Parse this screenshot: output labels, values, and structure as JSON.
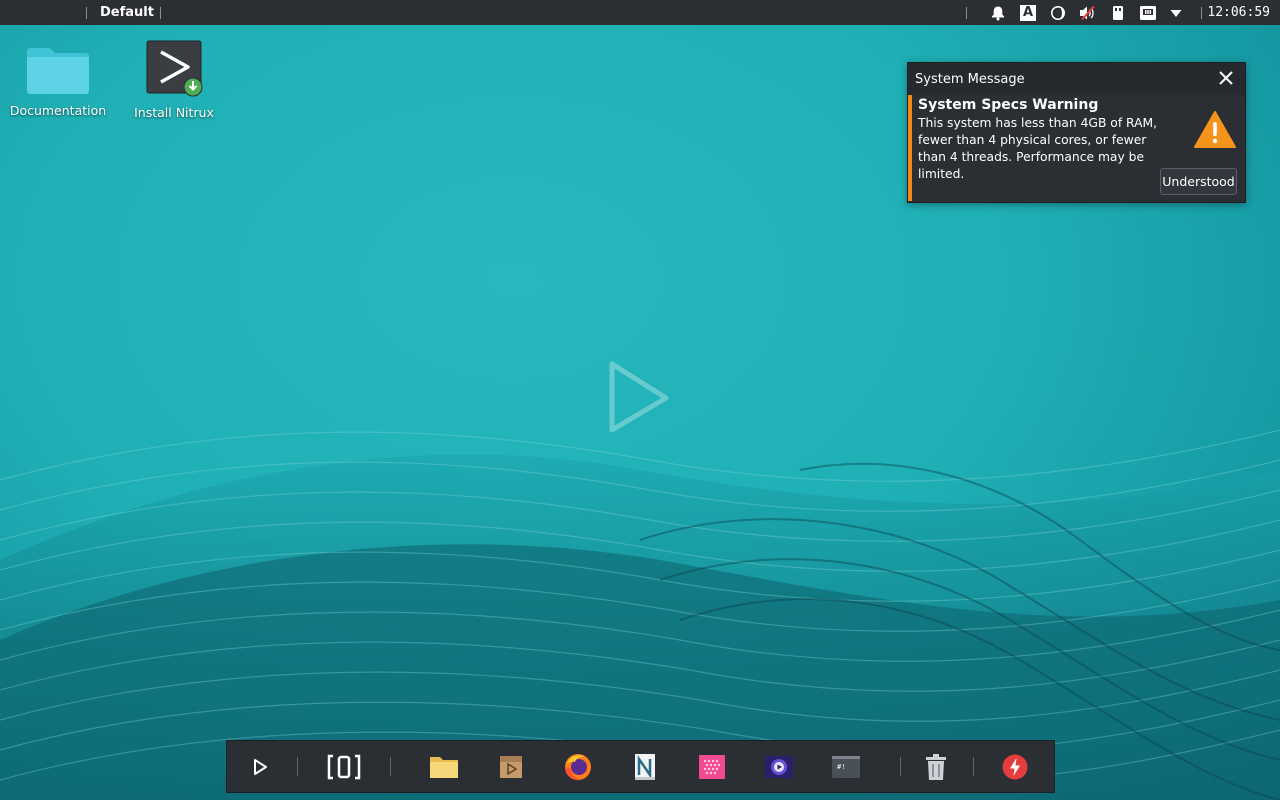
{
  "topbar": {
    "workspace_label": "Default",
    "clock": "12:06:59",
    "tray_icons": [
      "notifications-icon",
      "keyboard-layout-icon",
      "night-mode-icon",
      "volume-muted-icon",
      "usb-device-icon",
      "network-icon",
      "tray-expand-icon"
    ],
    "keyboard_letter": "A"
  },
  "desktop": {
    "icons": [
      {
        "label": "Documentation",
        "icon": "folder-icon"
      },
      {
        "label": "Install Nitrux",
        "icon": "installer-icon"
      }
    ]
  },
  "notification": {
    "app_name": "System Message",
    "title": "System Specs Warning",
    "body": "This system has less than 4GB of RAM, fewer than 4 physical cores, or fewer than 4 threads. Performance may be limited.",
    "button_label": "Understood",
    "accent_color": "#f08c17"
  },
  "dock": {
    "items": [
      "launcher-icon",
      "overview-icon",
      "file-manager-icon",
      "media-app-icon",
      "firefox-icon",
      "notes-app-icon",
      "pink-grid-app-icon",
      "video-player-icon",
      "terminal-icon",
      "trash-icon",
      "power-icon"
    ],
    "terminal_glyph": "#!"
  }
}
